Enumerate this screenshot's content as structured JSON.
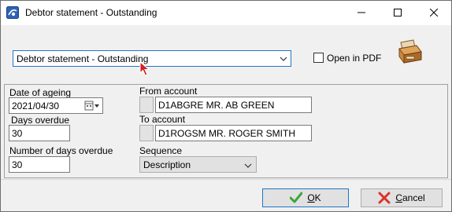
{
  "window": {
    "title": "Debtor statement - Outstanding"
  },
  "header": {
    "report_selected": "Debtor statement - Outstanding",
    "open_in_pdf_label": "Open in PDF",
    "open_in_pdf_checked": false
  },
  "form": {
    "date_of_ageing_label": "Date of ageing",
    "date_of_ageing_value": "2021/04/30",
    "days_overdue_label": "Days overdue",
    "days_overdue_value": "30",
    "number_of_days_overdue_label": "Number of days overdue",
    "number_of_days_overdue_value": "30",
    "from_account_label": "From account",
    "from_account_value": "D1ABGRE MR. AB GREEN",
    "to_account_label": "To account",
    "to_account_value": "D1ROGSM MR. ROGER SMITH",
    "sequence_label": "Sequence",
    "sequence_value": "Description"
  },
  "buttons": {
    "ok_first": "O",
    "ok_rest": "K",
    "cancel_first": "C",
    "cancel_rest": "ancel"
  },
  "icons": {
    "app": "app-icon",
    "minimize": "minimize-icon",
    "maximize": "maximize-icon",
    "close": "close-icon",
    "printer": "printer-icon",
    "calendar": "calendar-icon",
    "ok": "checkmark-icon",
    "cancel": "cross-icon"
  },
  "colors": {
    "accent": "#1f75c9",
    "ok_green": "#3da63a",
    "cancel_red": "#d9342b"
  }
}
